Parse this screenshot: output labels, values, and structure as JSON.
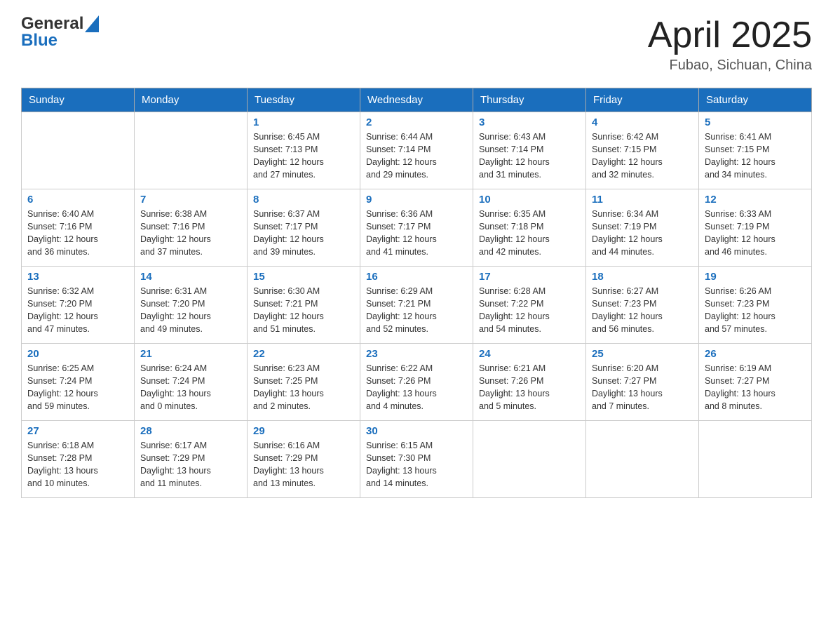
{
  "header": {
    "logo_general": "General",
    "logo_blue": "Blue",
    "month": "April 2025",
    "location": "Fubao, Sichuan, China"
  },
  "days_of_week": [
    "Sunday",
    "Monday",
    "Tuesday",
    "Wednesday",
    "Thursday",
    "Friday",
    "Saturday"
  ],
  "weeks": [
    [
      {
        "day": "",
        "info": ""
      },
      {
        "day": "",
        "info": ""
      },
      {
        "day": "1",
        "info": "Sunrise: 6:45 AM\nSunset: 7:13 PM\nDaylight: 12 hours\nand 27 minutes."
      },
      {
        "day": "2",
        "info": "Sunrise: 6:44 AM\nSunset: 7:14 PM\nDaylight: 12 hours\nand 29 minutes."
      },
      {
        "day": "3",
        "info": "Sunrise: 6:43 AM\nSunset: 7:14 PM\nDaylight: 12 hours\nand 31 minutes."
      },
      {
        "day": "4",
        "info": "Sunrise: 6:42 AM\nSunset: 7:15 PM\nDaylight: 12 hours\nand 32 minutes."
      },
      {
        "day": "5",
        "info": "Sunrise: 6:41 AM\nSunset: 7:15 PM\nDaylight: 12 hours\nand 34 minutes."
      }
    ],
    [
      {
        "day": "6",
        "info": "Sunrise: 6:40 AM\nSunset: 7:16 PM\nDaylight: 12 hours\nand 36 minutes."
      },
      {
        "day": "7",
        "info": "Sunrise: 6:38 AM\nSunset: 7:16 PM\nDaylight: 12 hours\nand 37 minutes."
      },
      {
        "day": "8",
        "info": "Sunrise: 6:37 AM\nSunset: 7:17 PM\nDaylight: 12 hours\nand 39 minutes."
      },
      {
        "day": "9",
        "info": "Sunrise: 6:36 AM\nSunset: 7:17 PM\nDaylight: 12 hours\nand 41 minutes."
      },
      {
        "day": "10",
        "info": "Sunrise: 6:35 AM\nSunset: 7:18 PM\nDaylight: 12 hours\nand 42 minutes."
      },
      {
        "day": "11",
        "info": "Sunrise: 6:34 AM\nSunset: 7:19 PM\nDaylight: 12 hours\nand 44 minutes."
      },
      {
        "day": "12",
        "info": "Sunrise: 6:33 AM\nSunset: 7:19 PM\nDaylight: 12 hours\nand 46 minutes."
      }
    ],
    [
      {
        "day": "13",
        "info": "Sunrise: 6:32 AM\nSunset: 7:20 PM\nDaylight: 12 hours\nand 47 minutes."
      },
      {
        "day": "14",
        "info": "Sunrise: 6:31 AM\nSunset: 7:20 PM\nDaylight: 12 hours\nand 49 minutes."
      },
      {
        "day": "15",
        "info": "Sunrise: 6:30 AM\nSunset: 7:21 PM\nDaylight: 12 hours\nand 51 minutes."
      },
      {
        "day": "16",
        "info": "Sunrise: 6:29 AM\nSunset: 7:21 PM\nDaylight: 12 hours\nand 52 minutes."
      },
      {
        "day": "17",
        "info": "Sunrise: 6:28 AM\nSunset: 7:22 PM\nDaylight: 12 hours\nand 54 minutes."
      },
      {
        "day": "18",
        "info": "Sunrise: 6:27 AM\nSunset: 7:23 PM\nDaylight: 12 hours\nand 56 minutes."
      },
      {
        "day": "19",
        "info": "Sunrise: 6:26 AM\nSunset: 7:23 PM\nDaylight: 12 hours\nand 57 minutes."
      }
    ],
    [
      {
        "day": "20",
        "info": "Sunrise: 6:25 AM\nSunset: 7:24 PM\nDaylight: 12 hours\nand 59 minutes."
      },
      {
        "day": "21",
        "info": "Sunrise: 6:24 AM\nSunset: 7:24 PM\nDaylight: 13 hours\nand 0 minutes."
      },
      {
        "day": "22",
        "info": "Sunrise: 6:23 AM\nSunset: 7:25 PM\nDaylight: 13 hours\nand 2 minutes."
      },
      {
        "day": "23",
        "info": "Sunrise: 6:22 AM\nSunset: 7:26 PM\nDaylight: 13 hours\nand 4 minutes."
      },
      {
        "day": "24",
        "info": "Sunrise: 6:21 AM\nSunset: 7:26 PM\nDaylight: 13 hours\nand 5 minutes."
      },
      {
        "day": "25",
        "info": "Sunrise: 6:20 AM\nSunset: 7:27 PM\nDaylight: 13 hours\nand 7 minutes."
      },
      {
        "day": "26",
        "info": "Sunrise: 6:19 AM\nSunset: 7:27 PM\nDaylight: 13 hours\nand 8 minutes."
      }
    ],
    [
      {
        "day": "27",
        "info": "Sunrise: 6:18 AM\nSunset: 7:28 PM\nDaylight: 13 hours\nand 10 minutes."
      },
      {
        "day": "28",
        "info": "Sunrise: 6:17 AM\nSunset: 7:29 PM\nDaylight: 13 hours\nand 11 minutes."
      },
      {
        "day": "29",
        "info": "Sunrise: 6:16 AM\nSunset: 7:29 PM\nDaylight: 13 hours\nand 13 minutes."
      },
      {
        "day": "30",
        "info": "Sunrise: 6:15 AM\nSunset: 7:30 PM\nDaylight: 13 hours\nand 14 minutes."
      },
      {
        "day": "",
        "info": ""
      },
      {
        "day": "",
        "info": ""
      },
      {
        "day": "",
        "info": ""
      }
    ]
  ]
}
